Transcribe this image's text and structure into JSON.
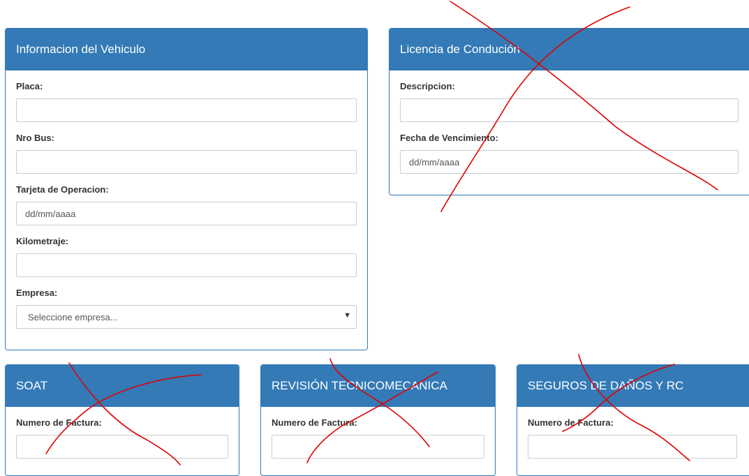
{
  "vehicle": {
    "title": "Informacion del Vehiculo",
    "placa_label": "Placa:",
    "nro_bus_label": "Nro Bus:",
    "tarjeta_label": "Tarjeta de Operacion:",
    "tarjeta_placeholder": "dd/mm/aaaa",
    "kilometraje_label": "Kilometraje:",
    "empresa_label": "Empresa:",
    "empresa_selected": "Seleccione empresa..."
  },
  "license": {
    "title": "Licencia de Condución",
    "descripcion_label": "Descripcion:",
    "fecha_label": "Fecha de Vencimiento:",
    "fecha_placeholder": "dd/mm/aaaa"
  },
  "soat": {
    "title": "SOAT",
    "factura_label": "Numero de Factura:"
  },
  "revision": {
    "title": "REVISIÓN TECNICOMECANICA",
    "factura_label": "Numero de Factura:"
  },
  "seguros": {
    "title": "SEGUROS DE DAÑOS Y RC",
    "factura_label": "Numero de Factura:"
  },
  "colors": {
    "primary": "#337ab7",
    "annotation": "#e00000"
  }
}
